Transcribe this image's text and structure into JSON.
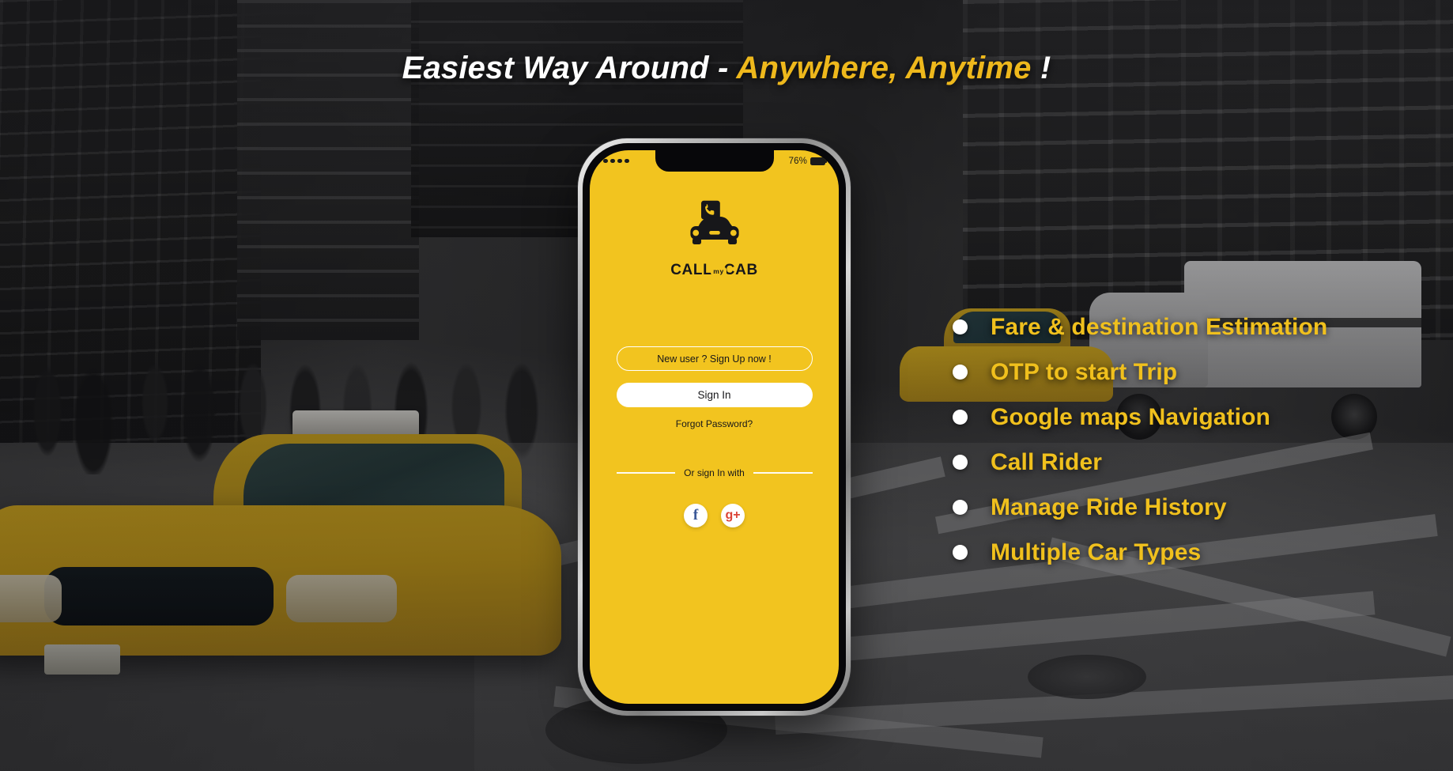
{
  "headline": {
    "part_white": "Easiest Way Around - ",
    "part_yellow": "Anywhere, Anytime",
    "part_white_end": " !"
  },
  "phone": {
    "statusbar": {
      "signal_icon": "signal-dots-icon",
      "battery_percent": "76%",
      "battery_icon": "battery-icon"
    },
    "logo": {
      "mark_icon": "call-my-cab-logo-icon",
      "word_first": "CALL",
      "word_badge": "my",
      "word_last": "CAB"
    },
    "auth": {
      "signup_label": "New user ? Sign Up now !",
      "signin_label": "Sign In",
      "forgot_label": "Forgot Password?",
      "divider_label": "Or sign In with",
      "social": [
        {
          "name": "facebook-icon",
          "glyph": "f"
        },
        {
          "name": "google-plus-icon",
          "glyph": "g+"
        }
      ]
    }
  },
  "features": [
    {
      "label": "Fare & destination Estimation"
    },
    {
      "label": "OTP to start Trip"
    },
    {
      "label": "Google maps Navigation"
    },
    {
      "label": "Call Rider"
    },
    {
      "label": "Manage Ride History"
    },
    {
      "label": "Multiple Car Types"
    }
  ],
  "colors": {
    "brand_yellow": "#f2c41f",
    "headline_yellow": "#eeb81c",
    "feature_yellow": "#f0c01d",
    "dark": "#17171a",
    "white": "#ffffff",
    "facebook_blue": "#3b5998",
    "google_red": "#db4437"
  }
}
